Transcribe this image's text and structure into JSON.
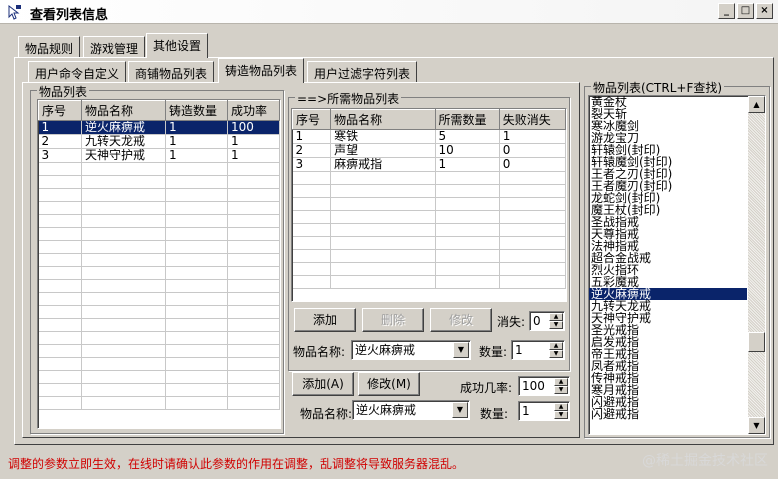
{
  "window": {
    "title": "查看列表信息",
    "controls": [
      "_",
      "□",
      "×"
    ]
  },
  "main_tabs": [
    {
      "label": "物品规则"
    },
    {
      "label": "游戏管理"
    },
    {
      "label": "其他设置"
    }
  ],
  "sub_tabs": [
    {
      "label": "用户命令自定义"
    },
    {
      "label": "商铺物品列表"
    },
    {
      "label": "铸造物品列表"
    },
    {
      "label": "用户过滤字符列表"
    }
  ],
  "item_list_group": {
    "label": "物品列表",
    "columns": [
      "序号",
      "物品名称",
      "铸造数量",
      "成功率"
    ],
    "rows": [
      [
        "1",
        "逆火麻痹戒",
        "1",
        "100"
      ],
      [
        "2",
        "九转天龙戒",
        "1",
        "1"
      ],
      [
        "3",
        "天神守护戒",
        "1",
        "1"
      ]
    ],
    "selected_index": 0
  },
  "required_items": {
    "label": "==>所需物品列表",
    "columns": [
      "序号",
      "物品名称",
      "所需数量",
      "失败消失"
    ],
    "rows": [
      [
        "1",
        "寒铁",
        "5",
        "1"
      ],
      [
        "2",
        "声望",
        "10",
        "0"
      ],
      [
        "3",
        "麻痹戒指",
        "1",
        "0"
      ]
    ],
    "buttons": {
      "add": "添加",
      "delete": "删除",
      "modify": "修改"
    },
    "vanish_label": "消失:",
    "vanish_value": "0",
    "name_label": "物品名称:",
    "name_value": "逆火麻痹戒",
    "qty_label": "数量:",
    "qty_value": "1"
  },
  "bottom_form": {
    "add_button": "添加(A)",
    "modify_button": "修改(M)",
    "success_label": "成功几率:",
    "success_value": "100",
    "name_label": "物品名称:",
    "name_value": "逆火麻痹戒",
    "qty_label": "数量:",
    "qty_value": "1"
  },
  "right_list": {
    "label": "物品列表(CTRL+F查找)",
    "items": [
      "黄金杖",
      "裂天斩",
      "寒冰魔剑",
      "游龙宝刀",
      "轩辕剑(封印)",
      "轩辕魔剑(封印)",
      "王者之刃(封印)",
      "王者魔刃(封印)",
      "龙蛇剑(封印)",
      "魔王杖(封印)",
      "圣战指戒",
      "天尊指戒",
      "法神指戒",
      "超合金战戒",
      "烈火指环",
      "五彩魔戒",
      "逆火麻痹戒",
      "九转天龙戒",
      "天神守护戒",
      "圣光戒指",
      "启发戒指",
      "帝王戒指",
      "凤者戒指",
      "传神戒指",
      "寒月戒指",
      "闪避戒指",
      "闪避戒指"
    ],
    "selected_index": 16
  },
  "status_message": "调整的参数立即生效，在线时请确认此参数的作用在调整，乱调整将导致服务器混乱。",
  "watermark": "@稀土掘金技术社区"
}
